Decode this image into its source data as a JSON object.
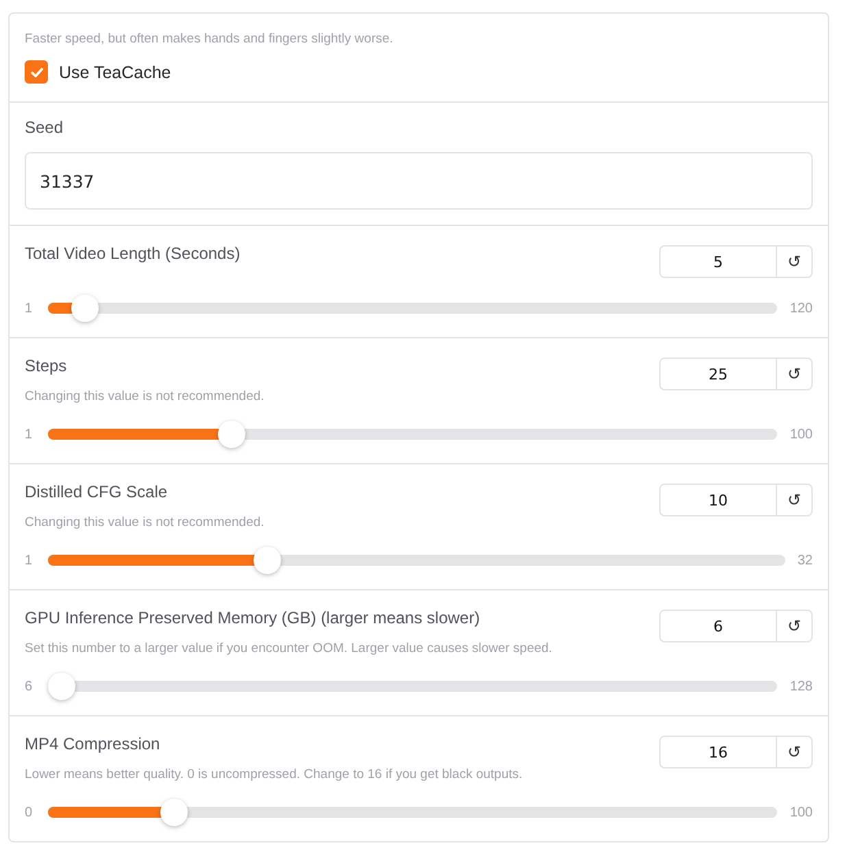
{
  "sections": [
    {
      "kind": "checkbox",
      "info": "Faster speed, but often makes hands and fingers slightly worse.",
      "label": "Use TeaCache",
      "checked": true
    },
    {
      "kind": "number",
      "label": "Seed",
      "value": "31337"
    },
    {
      "kind": "slider",
      "label": "Total Video Length (Seconds)",
      "value": "5",
      "reset": "↺",
      "min": "1",
      "max": "120",
      "level": 0.034
    },
    {
      "kind": "slider",
      "label": "Steps",
      "info": "Changing this value is not recommended.",
      "value": "25",
      "reset": "↺",
      "min": "1",
      "max": "100",
      "level": 0.242
    },
    {
      "kind": "slider",
      "label": "Distilled CFG Scale",
      "info": "Changing this value is not recommended.",
      "value": "10",
      "reset": "↺",
      "min": "1",
      "max": "32",
      "level": 0.29
    },
    {
      "kind": "slider",
      "label": "GPU Inference Preserved Memory (GB) (larger means slower)",
      "info": "Set this number to a larger value if you encounter OOM. Larger value causes slower speed.",
      "value": "6",
      "reset": "↺",
      "min": "6",
      "max": "128",
      "level": 0
    },
    {
      "kind": "slider",
      "label": "MP4 Compression",
      "info": "Lower means better quality. 0 is uncompressed. Change to 16 if you get black outputs.",
      "value": "16",
      "reset": "↺",
      "min": "0",
      "max": "100",
      "level": 0.16
    }
  ]
}
